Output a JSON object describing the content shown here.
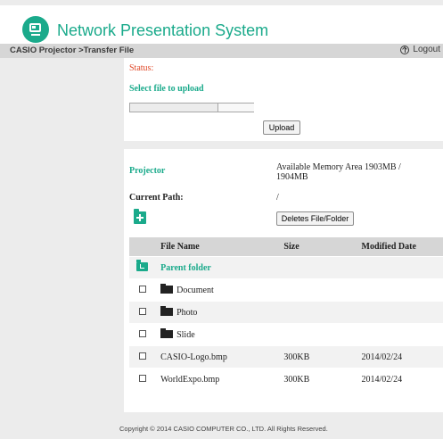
{
  "app": {
    "title": "Network Presentation System"
  },
  "nav": {
    "breadcrumb": "CASIO Projector >Transfer File",
    "logout_label": "Logout"
  },
  "upload": {
    "status_label": "Status:",
    "select_label": "Select file to upload",
    "upload_button": "Upload"
  },
  "projector": {
    "label": "Projector",
    "memory_text": "Available Memory Area 1903MB / 1904MB",
    "current_path_label": "Current Path:",
    "current_path_value": "/",
    "delete_button": "Deletes File/Folder"
  },
  "table": {
    "headers": {
      "name": "File Name",
      "size": "Size",
      "date": "Modified Date"
    },
    "parent_folder": "Parent folder",
    "rows": [
      {
        "name": "Document",
        "size": "",
        "date": ""
      },
      {
        "name": "Photo",
        "size": "",
        "date": ""
      },
      {
        "name": "Slide",
        "size": "",
        "date": ""
      },
      {
        "name": "CASIO-Logo.bmp",
        "size": "300KB",
        "date": "2014/02/24"
      },
      {
        "name": "WorldExpo.bmp",
        "size": "300KB",
        "date": "2014/02/24"
      }
    ]
  },
  "footer": {
    "copyright": "Copyright © 2014 CASIO COMPUTER CO., LTD. All Rights Reserved."
  },
  "colors": {
    "accent": "#1aaa8b",
    "status": "#e04a2a",
    "nav_bg": "#d6d6d6",
    "panel_bg": "#ececec"
  },
  "icons": {
    "logo": "projector-logo-icon",
    "logout": "logout-icon",
    "new_folder": "new-folder-icon",
    "parent": "parent-folder-icon",
    "folder": "folder-icon"
  }
}
